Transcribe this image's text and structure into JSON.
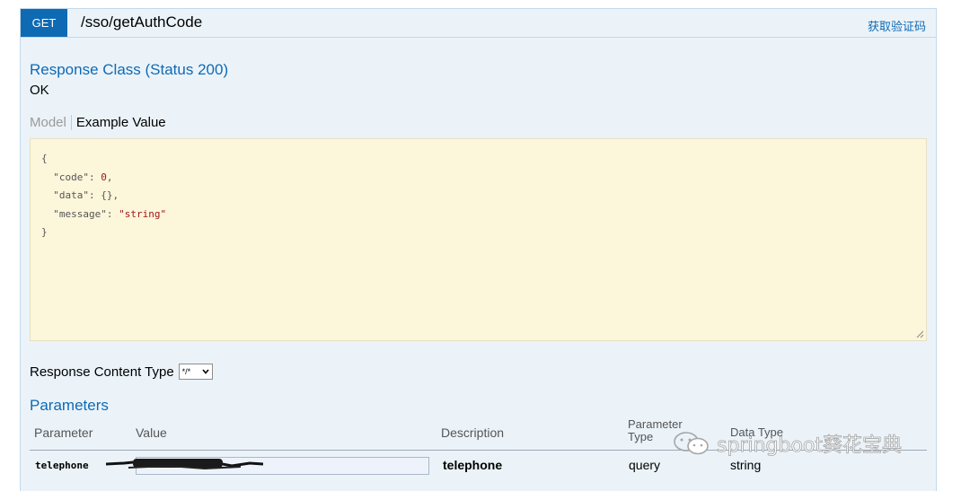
{
  "operation": {
    "method": "GET",
    "path": "/sso/getAuthCode",
    "summary": "获取验证码"
  },
  "response": {
    "class_title": "Response Class (Status 200)",
    "status_text": "OK",
    "tabs": {
      "model": "Model",
      "example": "Example Value"
    },
    "example_json": {
      "open": "{",
      "code_key": "\"code\"",
      "code_value": "0",
      "data_key": "\"data\"",
      "data_value": "{}",
      "message_key": "\"message\"",
      "message_value": "\"string\"",
      "close": "}"
    },
    "content_type_label": "Response Content Type",
    "content_type_selected": "*/*"
  },
  "parameters": {
    "title": "Parameters",
    "headers": {
      "parameter": "Parameter",
      "value": "Value",
      "description": "Description",
      "parameter_type": "Parameter Type",
      "data_type": "Data Type"
    },
    "rows": [
      {
        "parameter": "telephone",
        "description": "telephone",
        "parameter_type": "query",
        "data_type": "string"
      }
    ]
  },
  "watermark": {
    "text": "springboot葵花宝典"
  }
}
